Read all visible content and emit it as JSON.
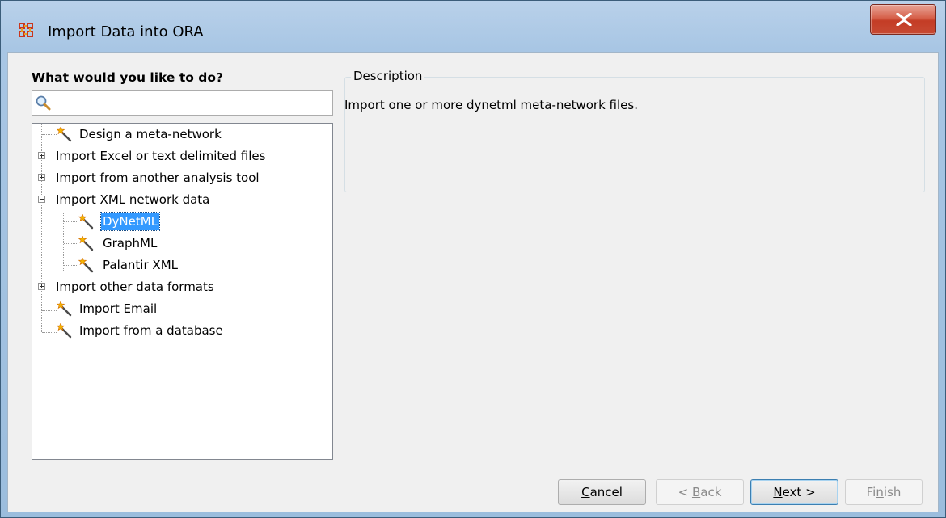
{
  "window": {
    "title": "Import Data into ORA",
    "icon": "ora-app-icon"
  },
  "left_panel": {
    "question": "What would you like to do?",
    "search": {
      "value": "",
      "placeholder": ""
    }
  },
  "tree": {
    "items": [
      {
        "label": "Design a meta-network",
        "icon": "wand-icon"
      },
      {
        "label": "Import Excel or text delimited files",
        "expander": "plus"
      },
      {
        "label": "Import from another analysis tool",
        "expander": "plus"
      },
      {
        "label": "Import XML network data",
        "expander": "minus",
        "children": [
          {
            "label": "DyNetML",
            "icon": "wand-icon",
            "selected": true
          },
          {
            "label": "GraphML",
            "icon": "wand-icon"
          },
          {
            "label": "Palantir XML",
            "icon": "wand-icon"
          }
        ]
      },
      {
        "label": "Import other data formats",
        "expander": "plus"
      },
      {
        "label": "Import Email",
        "icon": "wand-icon"
      },
      {
        "label": "Import from a database",
        "icon": "wand-icon"
      }
    ]
  },
  "description": {
    "legend": "Description",
    "text": "Import one or more dynetml meta-network files."
  },
  "buttons": {
    "cancel": {
      "mnemonic": "C",
      "rest": "ancel"
    },
    "back": {
      "prefix": "< ",
      "mnemonic": "B",
      "rest": "ack"
    },
    "next": {
      "mnemonic": "N",
      "rest": "ext >"
    },
    "finish": {
      "prefix": "Fi",
      "mnemonic": "n",
      "rest": "ish"
    }
  },
  "colors": {
    "selection": "#3399ff",
    "close_button": "#c43c25",
    "titlebar": "#b9d1ea"
  }
}
